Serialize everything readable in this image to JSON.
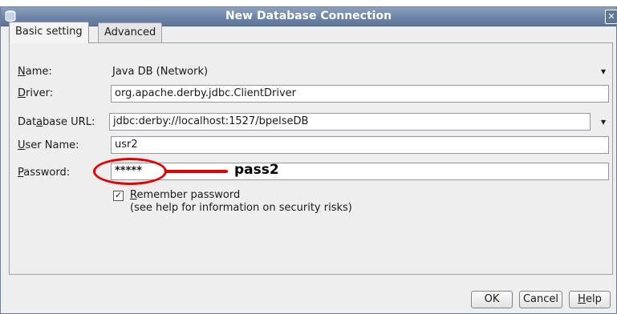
{
  "window": {
    "title": "New Database Connection",
    "close_glyph": "✕"
  },
  "tabs": [
    {
      "label": "Basic setting",
      "active": true
    },
    {
      "label": "Advanced",
      "active": false
    }
  ],
  "form": {
    "name": {
      "label_first": "N",
      "label_rest": "ame:",
      "value": "Java DB (Network)"
    },
    "driver": {
      "label_first": "D",
      "label_rest": "river:",
      "value": "org.apache.derby.jdbc.ClientDriver"
    },
    "url": {
      "label_pre": "Dat",
      "label_mn": "a",
      "label_rest": "base URL:",
      "value": "jdbc:derby://localhost:1527/bpelseDB"
    },
    "user": {
      "label_first": "U",
      "label_rest": "ser Name:",
      "value": "usr2"
    },
    "password": {
      "label_first": "P",
      "label_rest": "assword:",
      "value": "*****"
    },
    "remember": {
      "checked": true,
      "checkmark": "✓",
      "label_first": "R",
      "label_rest": "emember password",
      "hint": "(see help for information on security risks)"
    }
  },
  "buttons": {
    "ok": "OK",
    "cancel": "Cancel",
    "help_first": "H",
    "help_rest": "elp"
  },
  "annotation": {
    "text": "pass2",
    "color": "#e60000"
  },
  "icons": {
    "dropdown": "chevron-down-icon",
    "app": "database-icon",
    "close": "close-icon"
  }
}
